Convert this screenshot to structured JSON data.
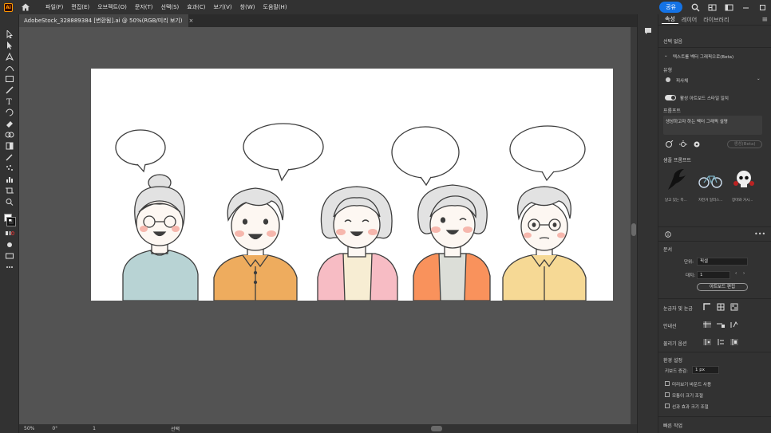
{
  "app": {
    "logo_text": "Ai",
    "menu": [
      "파일(F)",
      "편집(E)",
      "오브젝트(O)",
      "문자(T)",
      "선택(S)",
      "효과(C)",
      "보기(V)",
      "창(W)",
      "도움말(H)"
    ],
    "share_label": "공유"
  },
  "document_tab": {
    "title": "AdobeStock_328889384 [변환됨].ai @ 50%(RGB/미리 보기)",
    "close": "×"
  },
  "statusbar": {
    "zoom": "50%",
    "rotation": "0°",
    "artboard_index": "1",
    "tool_status": "선택"
  },
  "properties": {
    "tabs": [
      "속성",
      "레이어",
      "라이브러리"
    ],
    "no_selection": "선택 없음",
    "generative_section": "텍스트를 벡터 그래픽으로(Beta)",
    "type_label": "유형",
    "type_value": "피사체",
    "active_artboard_style": "활성 아트보드 스타일 일치",
    "prompt_label": "프롬프트",
    "prompt_placeholder": "생성하고자 하는 벡터 그래픽 설명",
    "generate_label": "생성(Beta)",
    "samples_label": "샘플 프롬프트",
    "samples": [
      "날고 있는 흑...",
      "자전거 일러스...",
      "장미와 거시..."
    ],
    "document_label": "문서",
    "units_label": "단위:",
    "units_value": "픽셀",
    "artboard_label": "대지:",
    "artboard_value": "1",
    "edit_artboard": "아트보드 편집",
    "rulers_grids": "눈금자 및 눈금",
    "guides": "안내선",
    "snap_options": "물리기 옵션",
    "prefs_label": "환경 설정",
    "keyboard_increment_label": "키보드 증감:",
    "keyboard_increment_value": "1 px",
    "check_preview_bounds": "미리보기 바운드 사용",
    "check_scale_corners": "모퉁이 크기 조절",
    "check_scale_strokes": "선과 효과 크기 조절",
    "quick_actions": "빠른 작업"
  },
  "colors": {
    "person1_shirt": "#b8d3d4",
    "person2_shirt": "#eeac5e",
    "person3_cardigan": "#f7bcc4",
    "person3_inner": "#f7edd3",
    "person4_cardigan": "#f9925c",
    "person4_inner": "#dcded8",
    "person5_shirt": "#f6d995",
    "hair": "#e2e2e2",
    "skin": "#fdf7f2",
    "cheek": "#f6b7ad",
    "accent": "#1473e6"
  }
}
